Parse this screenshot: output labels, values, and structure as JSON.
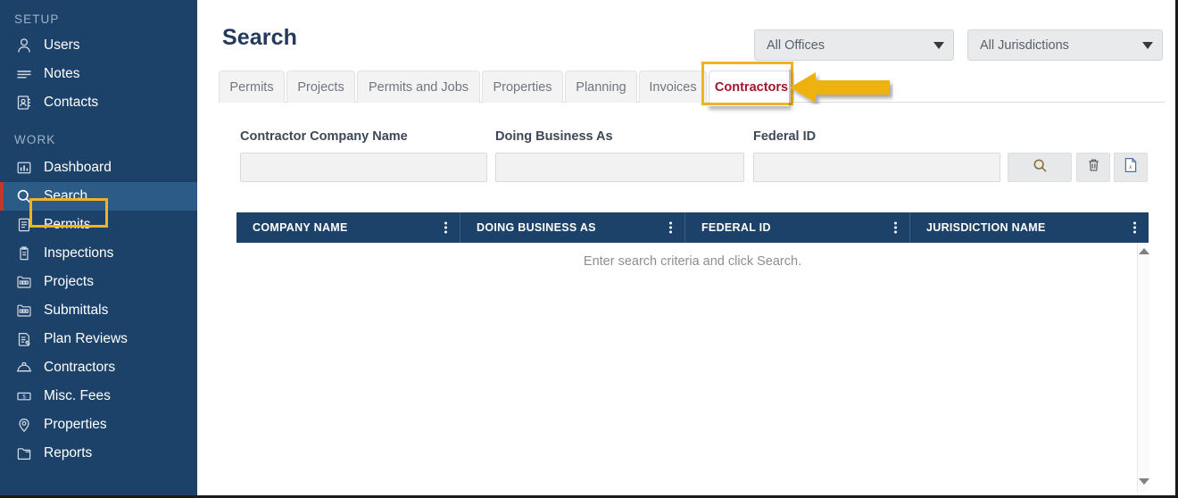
{
  "sidebar": {
    "sections": [
      {
        "label": "SETUP"
      },
      {
        "label": "WORK"
      }
    ],
    "setup_items": [
      {
        "label": "Users",
        "icon": "user-icon"
      },
      {
        "label": "Notes",
        "icon": "notes-icon"
      },
      {
        "label": "Contacts",
        "icon": "contacts-icon"
      }
    ],
    "work_items": [
      {
        "label": "Dashboard",
        "icon": "dashboard-icon"
      },
      {
        "label": "Search",
        "icon": "search-icon"
      },
      {
        "label": "Permits",
        "icon": "permits-icon"
      },
      {
        "label": "Inspections",
        "icon": "inspections-icon"
      },
      {
        "label": "Projects",
        "icon": "projects-icon"
      },
      {
        "label": "Submittals",
        "icon": "submittals-icon"
      },
      {
        "label": "Plan Reviews",
        "icon": "plan-reviews-icon"
      },
      {
        "label": "Contractors",
        "icon": "hardhat-icon"
      },
      {
        "label": "Misc. Fees",
        "icon": "money-icon"
      },
      {
        "label": "Properties",
        "icon": "location-pin-icon"
      },
      {
        "label": "Reports",
        "icon": "reports-folder-icon"
      }
    ],
    "active_item": "Search",
    "colors": {
      "background": "#1d4269",
      "active_background": "#2d5b87",
      "active_accent": "#c0392b",
      "section_text": "#9fb3c8"
    }
  },
  "header": {
    "title": "Search",
    "office_filter": {
      "value": "All Offices",
      "icon": "chevron-down-icon"
    },
    "jurisdiction_filter": {
      "value": "All Jurisdictions",
      "icon": "chevron-down-icon"
    }
  },
  "tabs": [
    {
      "label": "Permits",
      "active": false
    },
    {
      "label": "Projects",
      "active": false
    },
    {
      "label": "Permits and Jobs",
      "active": false
    },
    {
      "label": "Properties",
      "active": false
    },
    {
      "label": "Planning",
      "active": false
    },
    {
      "label": "Invoices",
      "active": false
    },
    {
      "label": "Contractors",
      "active": true
    }
  ],
  "annotation": {
    "highlight_color": "#f0b323",
    "arrow_direction": "left",
    "targets": [
      "Contractors tab",
      "Search sidebar item"
    ]
  },
  "search_form": {
    "fields": [
      {
        "label": "Contractor Company Name",
        "value": "",
        "placeholder": ""
      },
      {
        "label": "Doing Business As",
        "value": "",
        "placeholder": ""
      },
      {
        "label": "Federal ID",
        "value": "",
        "placeholder": ""
      }
    ],
    "buttons": [
      {
        "name": "search",
        "icon": "magnifier-icon",
        "label": ""
      },
      {
        "name": "clear",
        "icon": "trash-icon",
        "label": ""
      },
      {
        "name": "export",
        "icon": "excel-export-icon",
        "label": ""
      }
    ]
  },
  "results_table": {
    "columns": [
      "COMPANY NAME",
      "DOING BUSINESS AS",
      "FEDERAL ID",
      "JURISDICTION NAME"
    ],
    "rows": [],
    "empty_message": "Enter search criteria and click Search.",
    "header_background": "#1d4269"
  },
  "scrollbar": {
    "up_icon": "triangle-up-icon",
    "down_icon": "triangle-down-icon"
  }
}
